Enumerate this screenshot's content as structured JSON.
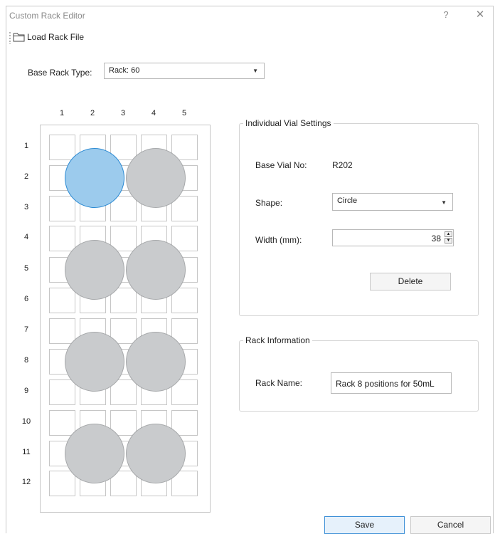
{
  "window": {
    "title": "Custom Rack Editor",
    "help_glyph": "?",
    "close_glyph": "✕"
  },
  "toolbar": {
    "load_label": "Load Rack File",
    "load_icon": "folder-icon"
  },
  "base_rack": {
    "label": "Base Rack Type:",
    "value": "Rack: 60"
  },
  "grid": {
    "columns": [
      "1",
      "2",
      "3",
      "4",
      "5"
    ],
    "rows": [
      "1",
      "2",
      "3",
      "4",
      "5",
      "6",
      "7",
      "8",
      "9",
      "10",
      "11",
      "12"
    ],
    "vials_count": 8,
    "selected_vial": "R202"
  },
  "vial_settings": {
    "title": "Individual Vial Settings",
    "base_vial_label": "Base Vial No:",
    "base_vial_value": "R202",
    "shape_label": "Shape:",
    "shape_value": "Circle",
    "width_label": "Width (mm):",
    "width_value": "38",
    "delete_label": "Delete"
  },
  "rack_info": {
    "title": "Rack Information",
    "name_label": "Rack Name:",
    "name_value": "Rack 8 positions for 50mL"
  },
  "footer": {
    "save_label": "Save",
    "cancel_label": "Cancel"
  },
  "colors": {
    "selected_vial_fill": "#9ccbed",
    "selected_vial_border": "#2d8bd3",
    "vial_fill": "#c9cbcd",
    "primary_button_border": "#3c8fd6"
  }
}
